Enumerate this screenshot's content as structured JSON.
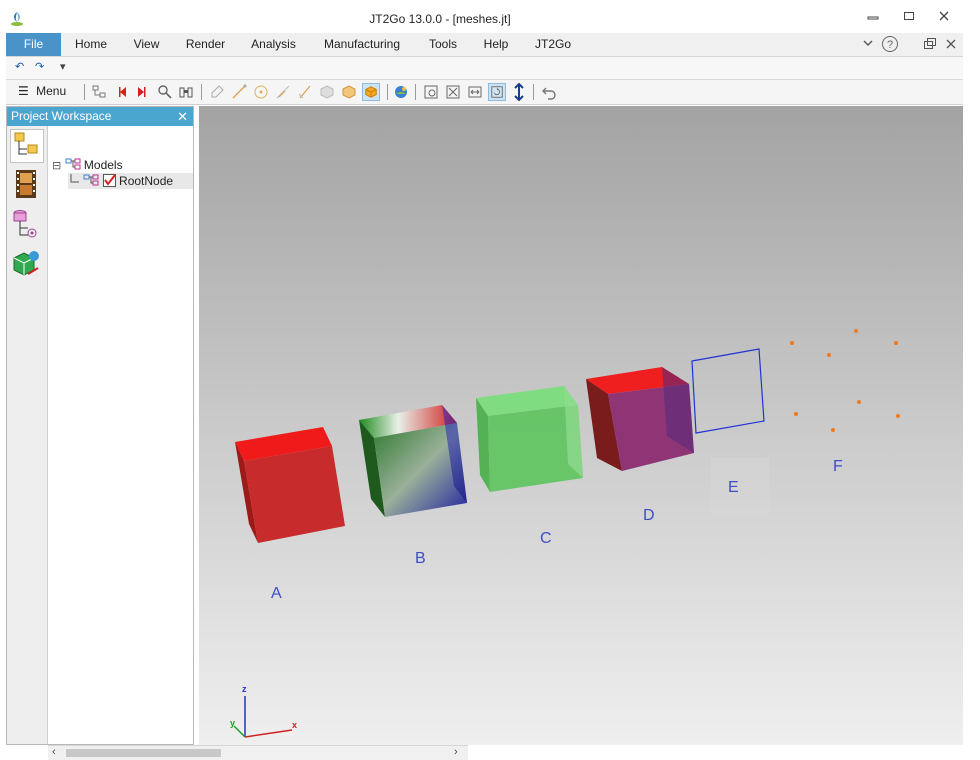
{
  "window": {
    "title": "JT2Go 13.0.0 - [meshes.jt]",
    "minimize": "▭",
    "restore": "▢",
    "close": "✕"
  },
  "ribbon": {
    "tabs": [
      "File",
      "Home",
      "View",
      "Render",
      "Analysis",
      "Manufacturing",
      "Tools",
      "Help",
      "JT2Go"
    ],
    "right_icons": [
      "chevron-down-icon",
      "help-icon",
      "restore-icon",
      "close-icon"
    ]
  },
  "qat": {
    "undo": "↶",
    "redo": "↷",
    "customize": "▾"
  },
  "toolbar": {
    "menu_label": "Menu"
  },
  "panel": {
    "title": "Project Workspace",
    "close": "✕",
    "tree": [
      {
        "label": "Models",
        "expander": "⊟"
      },
      {
        "label": "RootNode",
        "checked": true
      }
    ]
  },
  "viewport": {
    "labels": [
      "A",
      "B",
      "C",
      "D",
      "E",
      "F"
    ],
    "axes": {
      "x": "x",
      "y": "y",
      "z": "z"
    }
  },
  "colors": {
    "file_tab": "#4a93c9",
    "panel_header": "#4aa6cf",
    "label_blue": "#3c4ec6",
    "cube_a": "#d32a2a",
    "cube_c": "#5fcf5f",
    "cube_d_top": "#e82020",
    "cube_d_side": "#8b2f6f",
    "wire_e": "#1f33d8",
    "points_f": "#f07a1e"
  }
}
